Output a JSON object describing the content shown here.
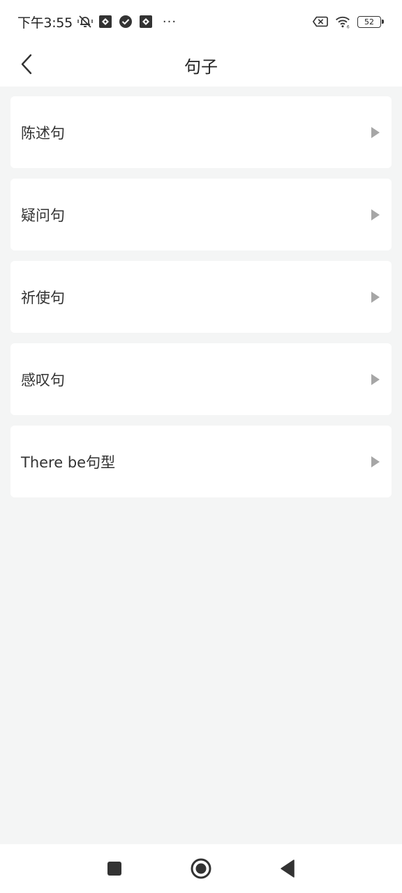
{
  "status_bar": {
    "time": "下午3:55",
    "icons_left": [
      "mute-bell-icon",
      "app-notification-icon",
      "check-circle-icon",
      "app-notification-icon"
    ],
    "more": "···",
    "icons_right": [
      "no-sim-icon",
      "wifi-icon"
    ],
    "battery": "52"
  },
  "header": {
    "title": "句子",
    "back_icon": "chevron-left-icon"
  },
  "list": {
    "items": [
      {
        "label": "陈述句"
      },
      {
        "label": "疑问句"
      },
      {
        "label": "祈使句"
      },
      {
        "label": "感叹句"
      },
      {
        "label": "There be句型"
      }
    ],
    "arrow_icon": "triangle-right-icon"
  },
  "system_nav": {
    "icons": [
      "recents-square-icon",
      "home-circle-icon",
      "back-triangle-icon"
    ]
  },
  "colors": {
    "background": "#f4f5f5",
    "card": "#ffffff",
    "text": "#333333",
    "arrow": "#a6a6a6"
  }
}
